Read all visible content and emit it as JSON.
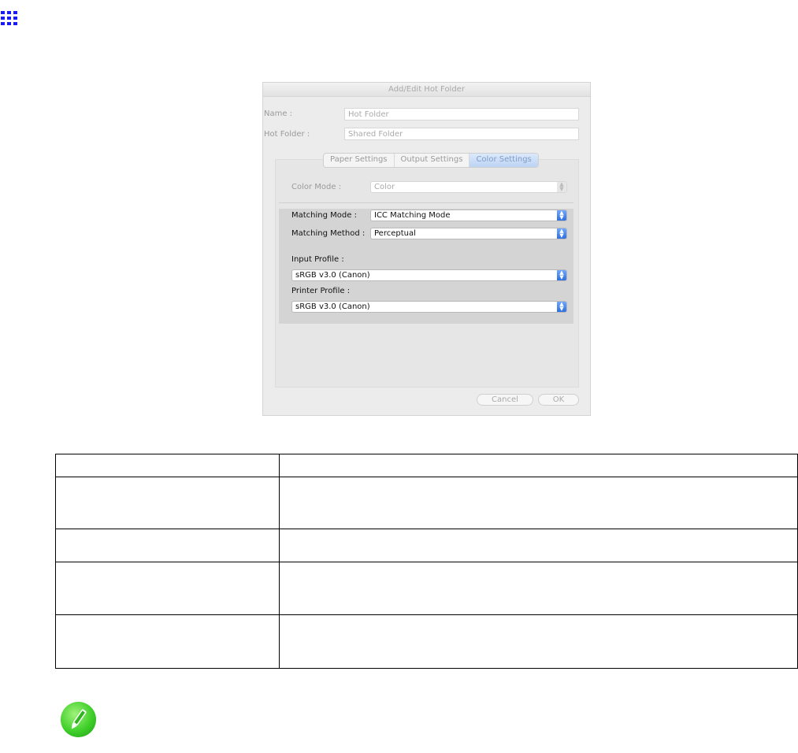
{
  "dialog": {
    "title": "Add/Edit Hot Folder",
    "name_label": "Name :",
    "name_value": "Hot Folder",
    "hot_folder_label": "Hot Folder :",
    "hot_folder_value": "Shared Folder",
    "tabs": [
      {
        "label": "Paper Settings"
      },
      {
        "label": "Output Settings"
      },
      {
        "label": "Color Settings",
        "active": true
      }
    ],
    "color_mode_label": "Color Mode :",
    "color_mode_value": "Color",
    "matching_mode_label": "Matching Mode :",
    "matching_mode_value": "ICC Matching Mode",
    "matching_method_label": "Matching Method :",
    "matching_method_value": "Perceptual",
    "input_profile_label": "Input Profile :",
    "input_profile_value": "sRGB v3.0 (Canon)",
    "printer_profile_label": "Printer Profile :",
    "printer_profile_value": "sRGB v3.0 (Canon)",
    "cancel_label": "Cancel",
    "ok_label": "OK"
  },
  "table": {
    "rows": [
      {
        "col1": "",
        "col2": ""
      },
      {
        "col1": "",
        "col2": ""
      },
      {
        "col1": "",
        "col2": ""
      },
      {
        "col1": "",
        "col2": ""
      },
      {
        "col1": "",
        "col2": ""
      }
    ]
  },
  "icons": {
    "top_left": "grid-icon",
    "note": "pencil-note-icon",
    "accent_color": "#1a1aff",
    "note_color": "#3fcf2a"
  }
}
